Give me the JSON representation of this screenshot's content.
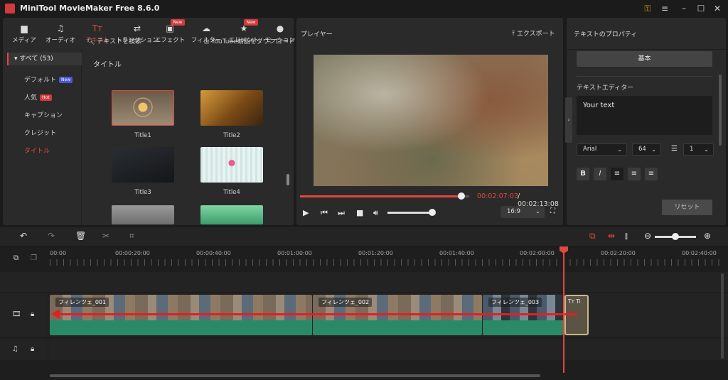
{
  "app": {
    "title": "MiniTool MovieMaker Free 8.6.0"
  },
  "toolbar": {
    "items": [
      {
        "label": "メディア",
        "icon": "folder-icon"
      },
      {
        "label": "オーディオ",
        "icon": "music-icon"
      },
      {
        "label": "テキスト",
        "icon": "text-icon",
        "active": true
      },
      {
        "label": "トランジション",
        "icon": "transition-icon"
      },
      {
        "label": "エフェクト",
        "icon": "effect-icon",
        "badge": "New"
      },
      {
        "label": "フィルター",
        "icon": "filter-icon"
      },
      {
        "label": "エレメント",
        "icon": "element-icon",
        "badge": "New"
      },
      {
        "label": "モーション",
        "icon": "motion-icon"
      }
    ]
  },
  "library": {
    "all_label": "すべて (53)",
    "categories": [
      {
        "label": "デフォルト",
        "tag": "New"
      },
      {
        "label": "人気",
        "tag": "Hot"
      },
      {
        "label": "キャプション"
      },
      {
        "label": "クレジット"
      },
      {
        "label": "タイトル",
        "selected": true
      }
    ],
    "search_label": "テキストを検索",
    "youtube_label": "YouTube動画をダウンロード",
    "section_heading": "タイトル",
    "thumbnails": [
      {
        "label": "Title1"
      },
      {
        "label": "Title2"
      },
      {
        "label": "Title3"
      },
      {
        "label": "Title4"
      }
    ]
  },
  "player": {
    "title": "プレイヤー",
    "export_label": "エクスポート",
    "time_current": "00:02:07:03",
    "time_total": "/ 00:02:13:08",
    "progress": 0.954,
    "volume": 0.95,
    "aspect_ratio": "16:9"
  },
  "properties": {
    "title": "テキストのプロパティ",
    "basic_tab": "基本",
    "editor_label": "テキストエディター",
    "editor_text": "Your text",
    "font": "Arial",
    "font_size": "64",
    "line_spacing": "1",
    "format_buttons": [
      "B",
      "I"
    ],
    "reset_label": "リセット"
  },
  "timeline": {
    "ruler_labels": [
      "00:00",
      "00:00:20:00",
      "00:00:40:00",
      "00:01:00:00",
      "00:01:20:00",
      "00:01:40:00",
      "00:02:00:00",
      "00:02:20:00",
      "00:02:40:00"
    ],
    "clips": [
      {
        "name": "フィレンツェ_001"
      },
      {
        "name": "フィレンツェ_002"
      },
      {
        "name": "フィレンツェ_003"
      }
    ],
    "text_clip_label": "Tт Ti",
    "zoom": 0.5
  },
  "colors": {
    "accent": "#e2473f",
    "clip_audio": "#2a8a68",
    "annotation_arrow": "#e2201f"
  }
}
